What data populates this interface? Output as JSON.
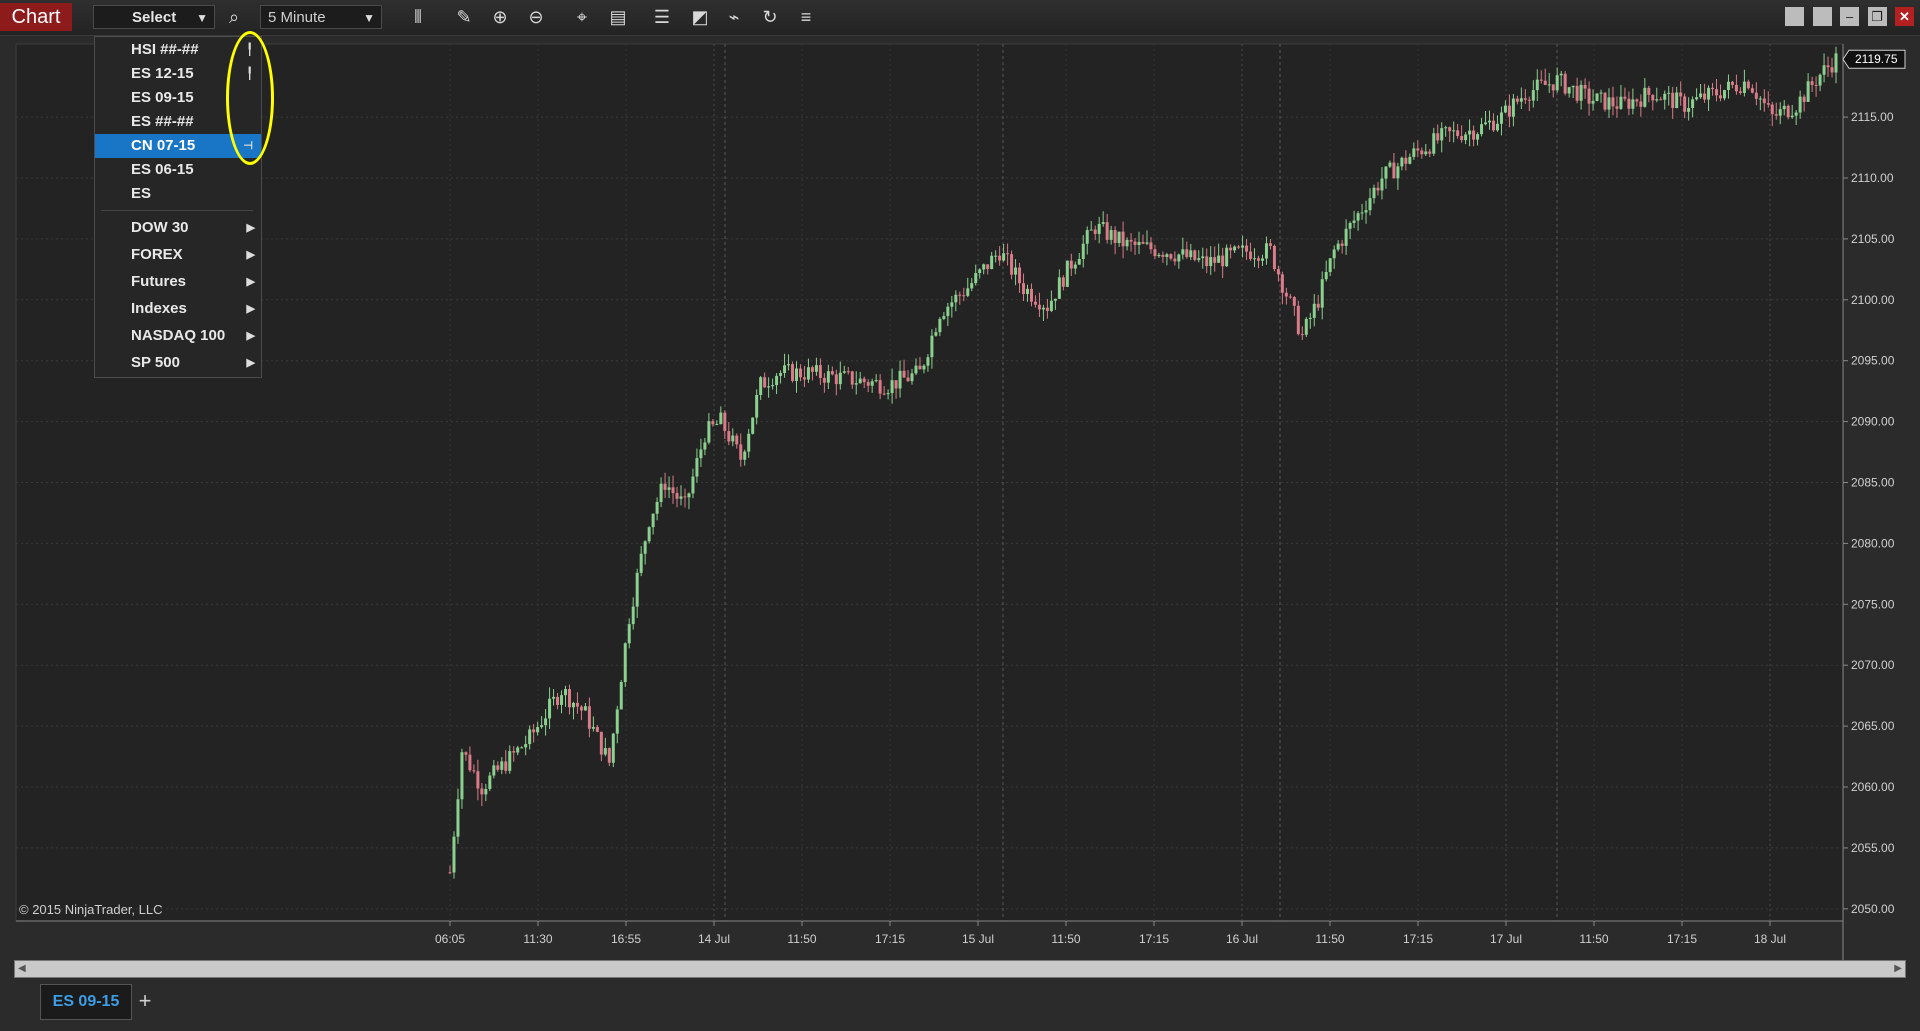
{
  "window": {
    "tab_label": "Chart"
  },
  "toolbar": {
    "instrument_select": "Select",
    "interval_select": "5 Minute",
    "icons": [
      "search-icon",
      "bar-style-icon",
      "pencil-icon",
      "zoom-in-icon",
      "zoom-out-icon",
      "crosshair-icon",
      "data-box-icon",
      "properties-icon",
      "strategy-icon",
      "indicator-icon",
      "reload-icon",
      "list-icon"
    ]
  },
  "menu": {
    "recent": [
      {
        "label": "HSI ##-##",
        "pin": "pin-icon"
      },
      {
        "label": "ES 12-15",
        "pin": "pin-icon"
      },
      {
        "label": "ES 09-15",
        "pin": ""
      },
      {
        "label": "ES ##-##",
        "pin": ""
      },
      {
        "label": "CN 07-15",
        "pin": "pin-icon",
        "selected": true
      },
      {
        "label": "ES 06-15",
        "pin": ""
      },
      {
        "label": "ES",
        "pin": ""
      }
    ],
    "lists": [
      "DOW 30",
      "FOREX",
      "Futures",
      "Indexes",
      "NASDAQ 100",
      "SP 500"
    ],
    "highlight_color": "#ffff00"
  },
  "chart_data": {
    "type": "candlestick",
    "interval": "5 Minute",
    "last_price": "2119.75",
    "copyright": "© 2015 NinjaTrader, LLC",
    "ylim": [
      2049,
      2121
    ],
    "y_ticks": [
      "2050.00",
      "2055.00",
      "2060.00",
      "2065.00",
      "2070.00",
      "2075.00",
      "2080.00",
      "2085.00",
      "2090.00",
      "2095.00",
      "2100.00",
      "2105.00",
      "2110.00",
      "2115.00"
    ],
    "x_ticks": [
      "06:05",
      "11:30",
      "16:55",
      "14 Jul",
      "11:50",
      "17:15",
      "15 Jul",
      "11:50",
      "17:15",
      "16 Jul",
      "11:50",
      "17:15",
      "17 Jul",
      "11:50",
      "17:15",
      "18 Jul"
    ],
    "close_path": [
      [
        0,
        2053
      ],
      [
        3,
        2063
      ],
      [
        8,
        2060
      ],
      [
        14,
        2062
      ],
      [
        20,
        2064
      ],
      [
        24,
        2066
      ],
      [
        28,
        2068
      ],
      [
        34,
        2066
      ],
      [
        40,
        2062
      ],
      [
        45,
        2074
      ],
      [
        50,
        2082
      ],
      [
        54,
        2085
      ],
      [
        59,
        2083
      ],
      [
        64,
        2089
      ],
      [
        68,
        2090
      ],
      [
        73,
        2087
      ],
      [
        78,
        2093
      ],
      [
        82,
        2094
      ],
      [
        90,
        2094
      ],
      [
        100,
        2093.5
      ],
      [
        110,
        2093
      ],
      [
        118,
        2094
      ],
      [
        123,
        2099
      ],
      [
        130,
        2101
      ],
      [
        138,
        2104
      ],
      [
        144,
        2101
      ],
      [
        150,
        2099.5
      ],
      [
        156,
        2103
      ],
      [
        162,
        2106
      ],
      [
        170,
        2104.5
      ],
      [
        180,
        2104
      ],
      [
        190,
        2103
      ],
      [
        200,
        2104
      ],
      [
        206,
        2104
      ],
      [
        214,
        2097
      ],
      [
        218,
        2100
      ],
      [
        222,
        2104
      ],
      [
        228,
        2107
      ],
      [
        234,
        2110
      ],
      [
        242,
        2112
      ],
      [
        250,
        2113.5
      ],
      [
        258,
        2114
      ],
      [
        264,
        2115
      ],
      [
        270,
        2117
      ],
      [
        278,
        2118
      ],
      [
        286,
        2116.5
      ],
      [
        294,
        2116
      ],
      [
        302,
        2117
      ],
      [
        310,
        2116
      ],
      [
        318,
        2117
      ],
      [
        326,
        2118
      ],
      [
        332,
        2115
      ],
      [
        338,
        2116
      ],
      [
        344,
        2118.5
      ],
      [
        348,
        2119.75
      ]
    ],
    "candle_colors": {
      "up": "#8ad18f",
      "down": "#d97b88"
    },
    "instrument_tab": "ES 09-15"
  }
}
